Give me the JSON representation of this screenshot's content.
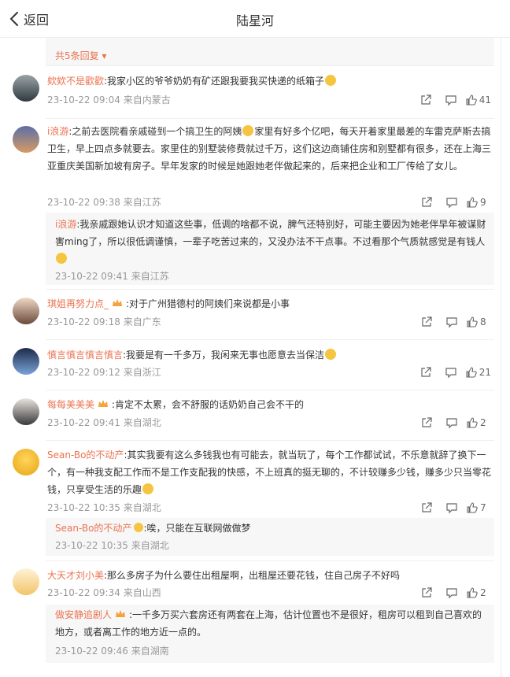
{
  "header": {
    "back_label": "返回",
    "title": "陆星河"
  },
  "more_replies": "共5条回复",
  "comments": [
    {
      "user": "欸欸不是歡歡",
      "text": ":我家小区的爷爷奶奶有矿还跟我要我买快递的纸箱子",
      "time": "23-10-22 09:04",
      "source": "来自内蒙古",
      "likes": "41"
    },
    {
      "user": "i浪游",
      "text1": ":之前去医院看亲戚碰到一个搞卫生的阿姨",
      "text2": "家里有好多个亿吧，每天开着家里最差的车雷克萨斯去搞卫生，早上四点多就要去。家里住的别墅装修费就过千万，这们这边商铺住房和别墅都有很多，还在上海三亚重庆美国新加坡有房子。早年发家的时候是她跟她老伴做起来的，后来把企业和工厂传给了女儿。",
      "time": "23-10-22 09:38",
      "source": "来自江苏",
      "likes": "9",
      "reply": {
        "user": "i浪游",
        "text": ":我亲戚跟她认识才知道这些事，低调的啥都不说，脾气还特别好，可能主要因为她老伴早年被谋财害ming了，所以很低调谨慎，一辈子吃苦过来的，又没办法不干点事。不过看那个气质就感觉是有钱人",
        "time": "23-10-22 09:41",
        "source": "来自江苏"
      }
    },
    {
      "user": "琪姐再努力点_",
      "text": ":对于广州猎德村的阿姨们来说都是小事",
      "time": "23-10-22 09:18",
      "source": "来自广东",
      "likes": "8"
    },
    {
      "user": "慎言慎言慎言慎言",
      "text": ":我要是有一千多万，我闲来无事也愿意去当保洁",
      "time": "23-10-22 09:12",
      "source": "来自浙江",
      "likes": "21"
    },
    {
      "user": "每每美美美",
      "text": ":肯定不太累，会不舒服的话奶奶自己会不干的",
      "time": "23-10-22 09:41",
      "source": "来自湖北",
      "likes": "2"
    },
    {
      "user": "Sean-Bo的不动产",
      "text": ":其实我要有这么多钱我也有可能去，就当玩了，每个工作都试试，不乐意就辞了换下一个，有一种我支配工作而不是工作支配我的快感，不上班真的挺无聊的，不计较赚多少钱，赚多少只当零花钱，只享受生活的乐趣",
      "time": "23-10-22 10:35",
      "source": "来自湖北",
      "likes": "7",
      "reply": {
        "user": "Sean-Bo的不动产",
        "text": ":唉，只能在互联网做做梦",
        "time": "23-10-22 10:35",
        "source": "来自湖北"
      }
    },
    {
      "user": "大天才刘小美",
      "text": ":那么多房子为什么要住出租屋啊，出租屋还要花钱，住自己房子不好吗",
      "time": "23-10-22 09:34",
      "source": "来自山西",
      "likes": "2",
      "reply": {
        "user": "做安静追剧人",
        "text": ":一千多万买六套房还有两套在上海，估计位置也不是很好，租房可以租到自己喜欢的地方，或者离工作的地方近一点的。",
        "time": "23-10-22 09:46",
        "source": "来自湖南"
      }
    }
  ],
  "colors": {
    "accent": "#eb7350",
    "muted": "#999999",
    "reply_bg": "#f7f7f7"
  },
  "icons": [
    "back-arrow-icon",
    "share-icon",
    "comment-icon",
    "like-icon",
    "crown-badge-icon",
    "emoji-icon"
  ]
}
